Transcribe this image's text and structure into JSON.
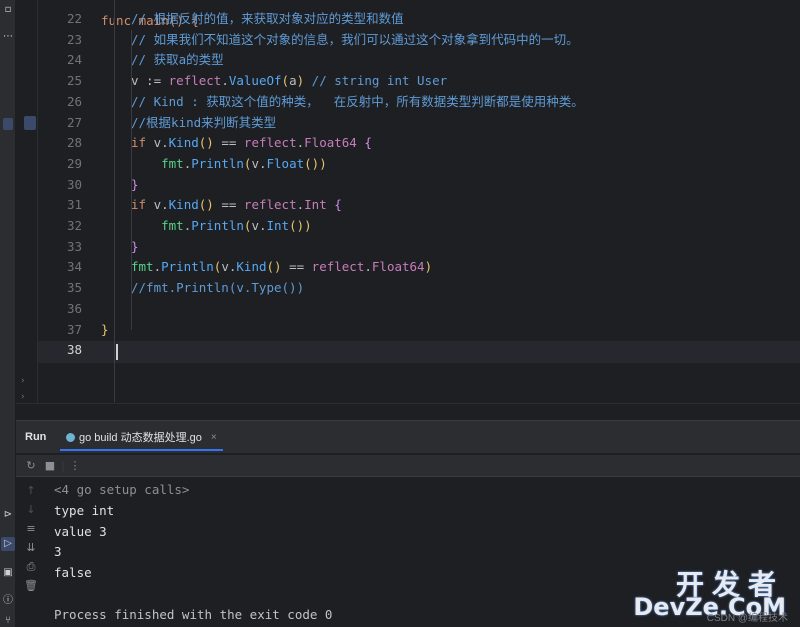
{
  "editor": {
    "top_partial": "func main() {",
    "lines": [
      {
        "num": "22",
        "segs": [
          [
            "c-com",
            "// 根据反射的值，来获取对象对应的类型和数值"
          ]
        ]
      },
      {
        "num": "23",
        "segs": [
          [
            "c-com",
            "// 如果我们不知道这个对象的信息，我们可以通过这个对象拿到代码中的一切。"
          ]
        ]
      },
      {
        "num": "24",
        "segs": [
          [
            "c-com",
            "// 获取a的类型"
          ]
        ]
      },
      {
        "num": "25",
        "segs": [
          [
            "c-var",
            "v := "
          ],
          [
            "c-pkg",
            "reflect"
          ],
          [
            "c-txt",
            "."
          ],
          [
            "c-fn",
            "ValueOf"
          ],
          [
            "c-paren",
            "("
          ],
          [
            "c-var",
            "a"
          ],
          [
            "c-paren",
            ")"
          ],
          [
            "c-com",
            " // string int User"
          ]
        ]
      },
      {
        "num": "26",
        "segs": [
          [
            "c-com",
            "// Kind : 获取这个值的种类，  在反射中，所有数据类型判断都是使用种类。"
          ]
        ]
      },
      {
        "num": "27",
        "segs": [
          [
            "c-com",
            "//根据kind来判断其类型"
          ]
        ]
      },
      {
        "num": "28",
        "segs": [
          [
            "c-kw",
            "if "
          ],
          [
            "c-var",
            "v."
          ],
          [
            "c-fn",
            "Kind"
          ],
          [
            "c-paren",
            "()"
          ],
          [
            "c-txt",
            " == "
          ],
          [
            "c-pkg",
            "reflect"
          ],
          [
            "c-txt",
            "."
          ],
          [
            "c-pkg",
            "Float64"
          ],
          [
            "c-brace2",
            " {"
          ]
        ]
      },
      {
        "num": "29",
        "segs": [
          [
            "c-txt",
            "    "
          ],
          [
            "c-grn",
            "fmt"
          ],
          [
            "c-txt",
            "."
          ],
          [
            "c-fn",
            "Println"
          ],
          [
            "c-paren",
            "("
          ],
          [
            "c-var",
            "v."
          ],
          [
            "c-fn",
            "Float"
          ],
          [
            "c-paren",
            "())"
          ]
        ]
      },
      {
        "num": "30",
        "segs": [
          [
            "c-brace2",
            "}"
          ]
        ]
      },
      {
        "num": "31",
        "segs": [
          [
            "c-kw",
            "if "
          ],
          [
            "c-var",
            "v."
          ],
          [
            "c-fn",
            "Kind"
          ],
          [
            "c-paren",
            "()"
          ],
          [
            "c-txt",
            " == "
          ],
          [
            "c-pkg",
            "reflect"
          ],
          [
            "c-txt",
            "."
          ],
          [
            "c-pkg",
            "Int"
          ],
          [
            "c-brace2",
            " {"
          ]
        ]
      },
      {
        "num": "32",
        "segs": [
          [
            "c-txt",
            "    "
          ],
          [
            "c-grn",
            "fmt"
          ],
          [
            "c-txt",
            "."
          ],
          [
            "c-fn",
            "Println"
          ],
          [
            "c-paren",
            "("
          ],
          [
            "c-var",
            "v."
          ],
          [
            "c-fn",
            "Int"
          ],
          [
            "c-paren",
            "())"
          ]
        ]
      },
      {
        "num": "33",
        "segs": [
          [
            "c-brace2",
            "}"
          ]
        ]
      },
      {
        "num": "34",
        "segs": [
          [
            "c-grn",
            "fmt"
          ],
          [
            "c-txt",
            "."
          ],
          [
            "c-fn",
            "Println"
          ],
          [
            "c-paren",
            "("
          ],
          [
            "c-var",
            "v."
          ],
          [
            "c-fn",
            "Kind"
          ],
          [
            "c-paren",
            "()"
          ],
          [
            "c-txt",
            " == "
          ],
          [
            "c-pkg",
            "reflect"
          ],
          [
            "c-txt",
            "."
          ],
          [
            "c-pkg",
            "Float64"
          ],
          [
            "c-paren",
            ")"
          ]
        ]
      },
      {
        "num": "35",
        "segs": [
          [
            "c-com",
            "//fmt.Println(v.Type())"
          ]
        ]
      },
      {
        "num": "36",
        "segs": []
      },
      {
        "num": "37",
        "segs": [
          [
            "c-brace1",
            "}"
          ]
        ]
      },
      {
        "num": "38",
        "segs": [],
        "active": true
      }
    ]
  },
  "run": {
    "title": "Run",
    "tab_label": "go build 动态数据处理.go",
    "tab_close": "×",
    "console": [
      {
        "text": "<4 go setup calls>",
        "kind": "setup"
      },
      {
        "text": "type int",
        "kind": "out"
      },
      {
        "text": "value 3",
        "kind": "out"
      },
      {
        "text": "3",
        "kind": "out"
      },
      {
        "text": "false",
        "kind": "out"
      },
      {
        "text": "",
        "kind": "out"
      },
      {
        "text": "Process finished with the exit code 0",
        "kind": "process"
      }
    ]
  },
  "watermark": {
    "cn": "开发者",
    "en": "DevZe.CoM",
    "sub": "CSDN @编程技术"
  },
  "icons": {
    "rerun": "rerun-icon",
    "stop": "stop-icon",
    "more": "more-icon",
    "up": "arrow-up-icon",
    "down": "arrow-down-icon",
    "wrap": "soft-wrap-icon",
    "scroll_end": "scroll-to-end-icon",
    "print": "print-icon",
    "trash": "trash-icon"
  }
}
